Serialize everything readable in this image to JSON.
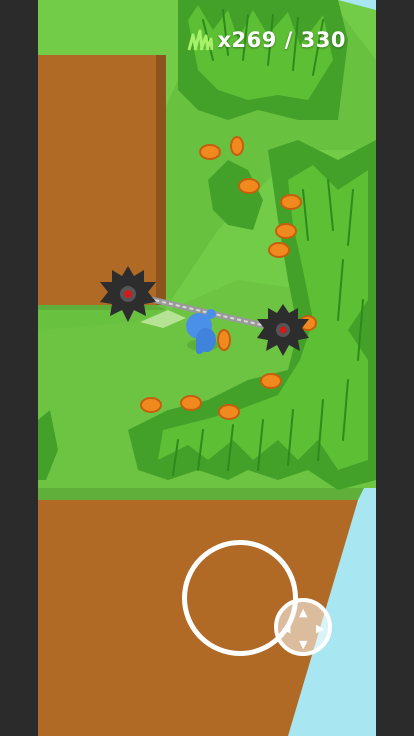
{
  "hud": {
    "counter_text": "x269 / 330",
    "icon": "grass-icon"
  },
  "collected": 269,
  "goal": 330,
  "joystick": {
    "icon": "move-arrows-icon"
  },
  "colors": {
    "sky": "#a8e6f2",
    "lawn_light": "#72cc47",
    "lawn_cut": "#62bb3c",
    "dirt": "#b06a25",
    "coin": "#f08a1e",
    "player": "#4a90e8",
    "blade": "#333333"
  }
}
